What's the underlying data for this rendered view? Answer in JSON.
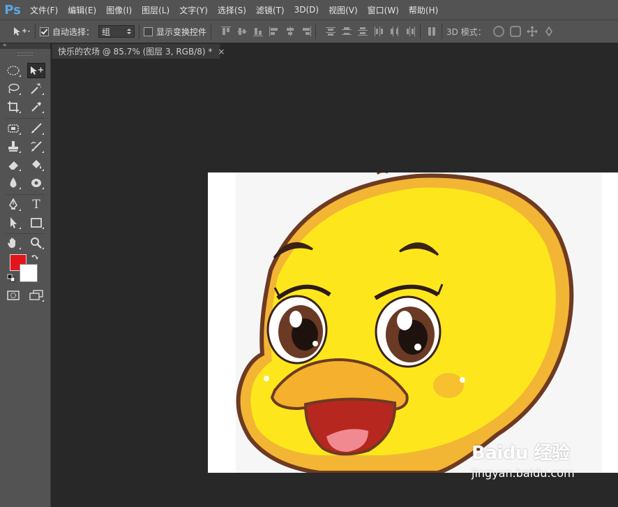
{
  "app": {
    "logo": "Ps"
  },
  "menu": [
    "文件(F)",
    "编辑(E)",
    "图像(I)",
    "图层(L)",
    "文字(Y)",
    "选择(S)",
    "滤镜(T)",
    "3D(D)",
    "视图(V)",
    "窗口(W)",
    "帮助(H)"
  ],
  "options": {
    "auto_select_label": "自动选择：",
    "auto_select_checked": true,
    "auto_select_value": "组",
    "show_transform_label": "显示变换控件",
    "show_transform_checked": false,
    "mode_3d_label": "3D 模式："
  },
  "document": {
    "tab_title": "快乐的农场 @ 85.7% (图层 3, RGB/8) *",
    "close_glyph": "×"
  },
  "colors": {
    "foreground": "#e3141c",
    "background": "#ffffff",
    "accent": "#5aa7e4"
  },
  "tools": [
    "elliptical-marquee-icon",
    "move-icon",
    "lasso-icon",
    "magic-wand-icon",
    "crop-icon",
    "eyedropper-icon",
    "spot-healing-icon",
    "brush-icon",
    "clone-stamp-icon",
    "history-brush-icon",
    "eraser-icon",
    "paint-bucket-icon",
    "blur-icon",
    "dodge-icon",
    "pen-icon",
    "type-icon",
    "path-selection-icon",
    "rectangle-icon",
    "hand-icon",
    "zoom-icon",
    "quick-mask-icon",
    "screen-mode-icon"
  ],
  "type_tool_glyph": "T",
  "watermark": {
    "logo": "Baidu 经验",
    "url": "jingyan.baidu.com"
  }
}
